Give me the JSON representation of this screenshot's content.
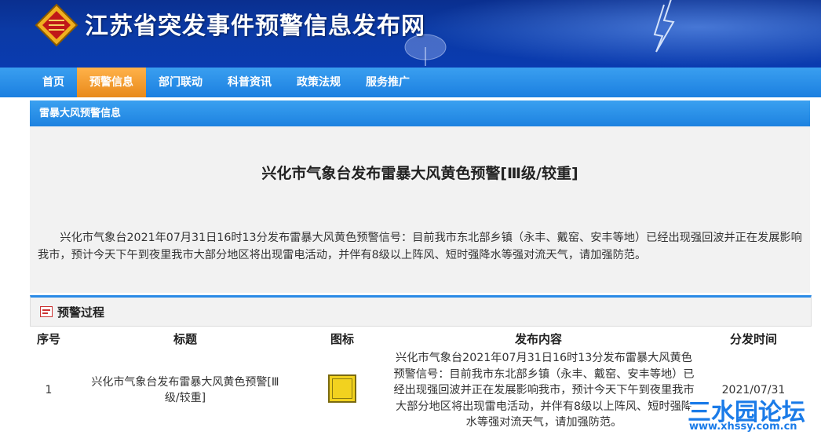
{
  "site": {
    "title": "江苏省突发事件预警信息发布网",
    "logo_icon": "emblem-icon"
  },
  "nav": {
    "items": [
      {
        "label": "首页"
      },
      {
        "label": "预警信息"
      },
      {
        "label": "部门联动"
      },
      {
        "label": "科普资讯"
      },
      {
        "label": "政策法规"
      },
      {
        "label": "服务推广"
      }
    ],
    "active_index": 1
  },
  "panel": {
    "heading": "雷暴大风预警信息",
    "article_title": "兴化市气象台发布雷暴大风黄色预警[Ⅲ级/较重]",
    "article_body": "兴化市气象台2021年07月31日16时13分发布雷暴大风黄色预警信号：目前我市东北部乡镇（永丰、戴窑、安丰等地）已经出现强回波并正在发展影响我市，预计今天下午到夜里我市大部分地区将出现雷电活动，并伴有8级以上阵风、短时强降水等强对流天气，请加强防范。"
  },
  "process": {
    "heading": "预警过程",
    "columns": [
      "序号",
      "标题",
      "图标",
      "发布内容",
      "分发时间"
    ],
    "rows": [
      {
        "no": "1",
        "title": "兴化市气象台发布雷暴大风黄色预警[Ⅲ级/较重]",
        "icon": "yellow-warning-icon",
        "content": "兴化市气象台2021年07月31日16时13分发布雷暴大风黄色预警信号：目前我市东北部乡镇（永丰、戴窑、安丰等地）已经出现强回波并正在发展影响我市，预计今天下午到夜里我市大部分地区将出现雷电活动，并伴有8级以上阵风、短时强降水等强对流天气，请加强防范。",
        "time": "2021/07/31"
      }
    ]
  },
  "watermark": {
    "name": "三水园论坛",
    "url": "www.xhssy.com.cn"
  },
  "colors": {
    "banner": "#0b3aa5",
    "nav": "#1b7fe0",
    "nav_active": "#e8891a",
    "warning_yellow": "#f2d21f"
  }
}
